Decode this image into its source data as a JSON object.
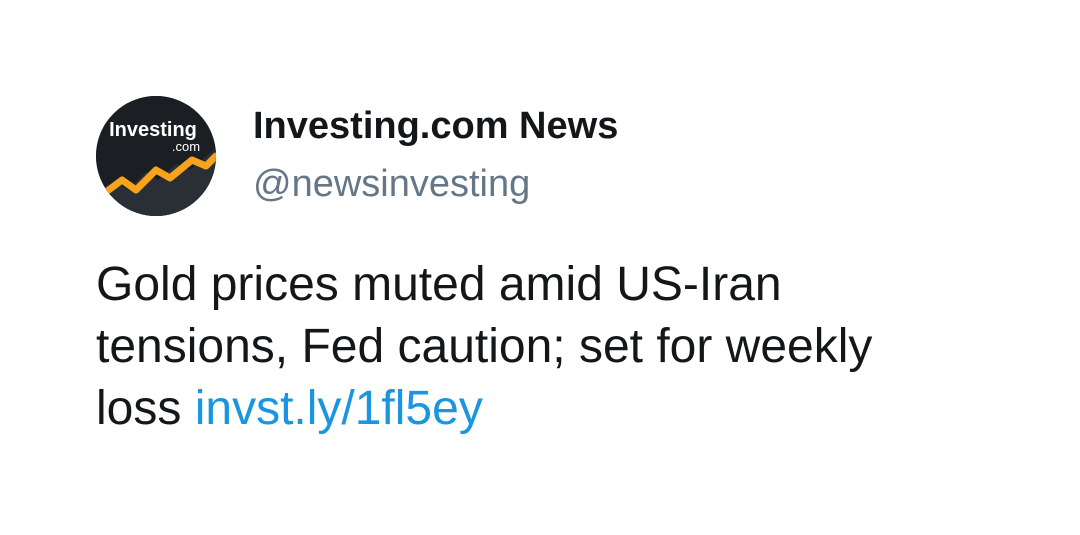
{
  "author": {
    "display_name": "Investing.com News",
    "handle": "@newsinvesting",
    "avatar": {
      "icon": "investing-logo-icon",
      "logo_text": "Investing",
      "logo_subtext": ".com"
    }
  },
  "tweet": {
    "text_line_1": "Gold prices muted amid US-Iran",
    "text_line_2": "tensions, Fed caution; set for weekly",
    "text_line_3": "loss",
    "link": "invst.ly/1fl5ey"
  },
  "colors": {
    "background": "#ffffff",
    "text": "#14171a",
    "handle": "#657786",
    "link": "#1b95e0",
    "logo_background": "#1b1e22",
    "logo_accent": "#f7a31c"
  }
}
